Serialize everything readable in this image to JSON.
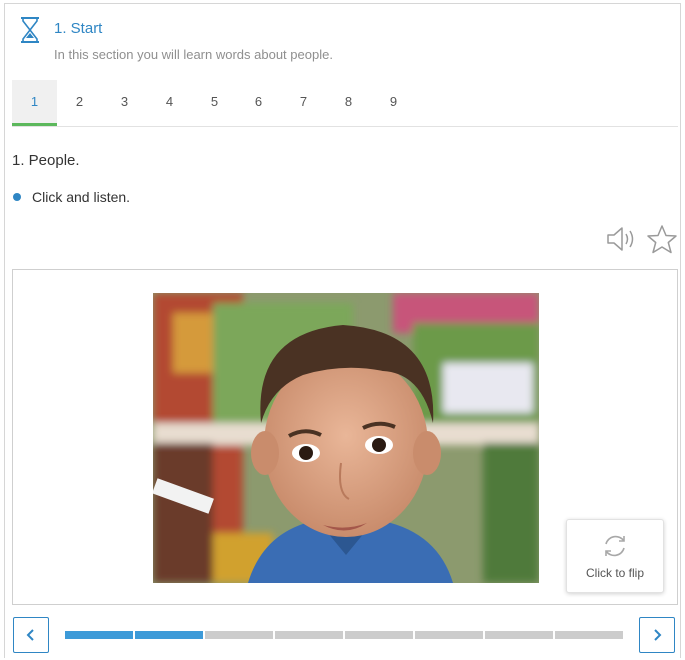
{
  "header": {
    "title": "1. Start",
    "subtitle": "In this section you will learn words about people.",
    "icon": "hourglass-icon"
  },
  "tabs": {
    "items": [
      "1",
      "2",
      "3",
      "4",
      "5",
      "6",
      "7",
      "8",
      "9"
    ],
    "active_index": 0
  },
  "content": {
    "heading": "1. People.",
    "instruction": "Click and listen."
  },
  "toolbar": {
    "icons": [
      "speaker-icon",
      "star-icon"
    ]
  },
  "card": {
    "flip_label": "Click to flip",
    "flip_icon": "refresh-icon"
  },
  "navigation": {
    "prev_icon": "chevron-left-icon",
    "next_icon": "chevron-right-icon"
  },
  "progress": {
    "total_segments": 8,
    "completed_segments": 2
  },
  "colors": {
    "accent": "#2f86c4",
    "active_tab_underline": "#5cb85c",
    "progress_done": "#3d9ad8",
    "progress_todo": "#cccccc"
  }
}
